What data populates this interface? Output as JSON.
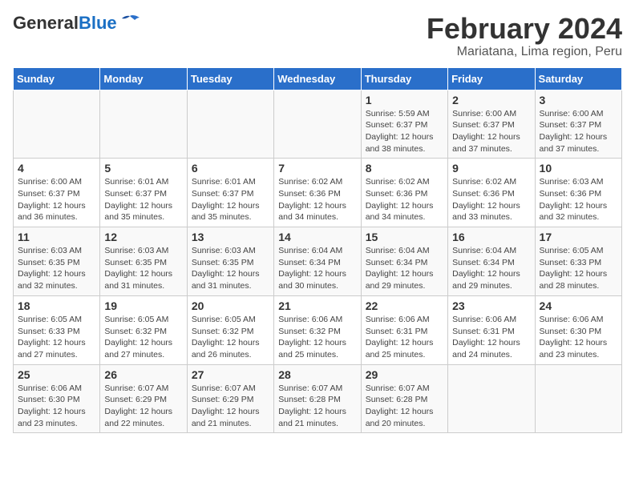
{
  "header": {
    "logo_general": "General",
    "logo_blue": "Blue",
    "title": "February 2024",
    "subtitle": "Mariatana, Lima region, Peru"
  },
  "calendar": {
    "days_of_week": [
      "Sunday",
      "Monday",
      "Tuesday",
      "Wednesday",
      "Thursday",
      "Friday",
      "Saturday"
    ],
    "weeks": [
      [
        {
          "day": "",
          "info": ""
        },
        {
          "day": "",
          "info": ""
        },
        {
          "day": "",
          "info": ""
        },
        {
          "day": "",
          "info": ""
        },
        {
          "day": "1",
          "info": "Sunrise: 5:59 AM\nSunset: 6:37 PM\nDaylight: 12 hours\nand 38 minutes."
        },
        {
          "day": "2",
          "info": "Sunrise: 6:00 AM\nSunset: 6:37 PM\nDaylight: 12 hours\nand 37 minutes."
        },
        {
          "day": "3",
          "info": "Sunrise: 6:00 AM\nSunset: 6:37 PM\nDaylight: 12 hours\nand 37 minutes."
        }
      ],
      [
        {
          "day": "4",
          "info": "Sunrise: 6:00 AM\nSunset: 6:37 PM\nDaylight: 12 hours\nand 36 minutes."
        },
        {
          "day": "5",
          "info": "Sunrise: 6:01 AM\nSunset: 6:37 PM\nDaylight: 12 hours\nand 35 minutes."
        },
        {
          "day": "6",
          "info": "Sunrise: 6:01 AM\nSunset: 6:37 PM\nDaylight: 12 hours\nand 35 minutes."
        },
        {
          "day": "7",
          "info": "Sunrise: 6:02 AM\nSunset: 6:36 PM\nDaylight: 12 hours\nand 34 minutes."
        },
        {
          "day": "8",
          "info": "Sunrise: 6:02 AM\nSunset: 6:36 PM\nDaylight: 12 hours\nand 34 minutes."
        },
        {
          "day": "9",
          "info": "Sunrise: 6:02 AM\nSunset: 6:36 PM\nDaylight: 12 hours\nand 33 minutes."
        },
        {
          "day": "10",
          "info": "Sunrise: 6:03 AM\nSunset: 6:36 PM\nDaylight: 12 hours\nand 32 minutes."
        }
      ],
      [
        {
          "day": "11",
          "info": "Sunrise: 6:03 AM\nSunset: 6:35 PM\nDaylight: 12 hours\nand 32 minutes."
        },
        {
          "day": "12",
          "info": "Sunrise: 6:03 AM\nSunset: 6:35 PM\nDaylight: 12 hours\nand 31 minutes."
        },
        {
          "day": "13",
          "info": "Sunrise: 6:03 AM\nSunset: 6:35 PM\nDaylight: 12 hours\nand 31 minutes."
        },
        {
          "day": "14",
          "info": "Sunrise: 6:04 AM\nSunset: 6:34 PM\nDaylight: 12 hours\nand 30 minutes."
        },
        {
          "day": "15",
          "info": "Sunrise: 6:04 AM\nSunset: 6:34 PM\nDaylight: 12 hours\nand 29 minutes."
        },
        {
          "day": "16",
          "info": "Sunrise: 6:04 AM\nSunset: 6:34 PM\nDaylight: 12 hours\nand 29 minutes."
        },
        {
          "day": "17",
          "info": "Sunrise: 6:05 AM\nSunset: 6:33 PM\nDaylight: 12 hours\nand 28 minutes."
        }
      ],
      [
        {
          "day": "18",
          "info": "Sunrise: 6:05 AM\nSunset: 6:33 PM\nDaylight: 12 hours\nand 27 minutes."
        },
        {
          "day": "19",
          "info": "Sunrise: 6:05 AM\nSunset: 6:32 PM\nDaylight: 12 hours\nand 27 minutes."
        },
        {
          "day": "20",
          "info": "Sunrise: 6:05 AM\nSunset: 6:32 PM\nDaylight: 12 hours\nand 26 minutes."
        },
        {
          "day": "21",
          "info": "Sunrise: 6:06 AM\nSunset: 6:32 PM\nDaylight: 12 hours\nand 25 minutes."
        },
        {
          "day": "22",
          "info": "Sunrise: 6:06 AM\nSunset: 6:31 PM\nDaylight: 12 hours\nand 25 minutes."
        },
        {
          "day": "23",
          "info": "Sunrise: 6:06 AM\nSunset: 6:31 PM\nDaylight: 12 hours\nand 24 minutes."
        },
        {
          "day": "24",
          "info": "Sunrise: 6:06 AM\nSunset: 6:30 PM\nDaylight: 12 hours\nand 23 minutes."
        }
      ],
      [
        {
          "day": "25",
          "info": "Sunrise: 6:06 AM\nSunset: 6:30 PM\nDaylight: 12 hours\nand 23 minutes."
        },
        {
          "day": "26",
          "info": "Sunrise: 6:07 AM\nSunset: 6:29 PM\nDaylight: 12 hours\nand 22 minutes."
        },
        {
          "day": "27",
          "info": "Sunrise: 6:07 AM\nSunset: 6:29 PM\nDaylight: 12 hours\nand 21 minutes."
        },
        {
          "day": "28",
          "info": "Sunrise: 6:07 AM\nSunset: 6:28 PM\nDaylight: 12 hours\nand 21 minutes."
        },
        {
          "day": "29",
          "info": "Sunrise: 6:07 AM\nSunset: 6:28 PM\nDaylight: 12 hours\nand 20 minutes."
        },
        {
          "day": "",
          "info": ""
        },
        {
          "day": "",
          "info": ""
        }
      ]
    ]
  }
}
